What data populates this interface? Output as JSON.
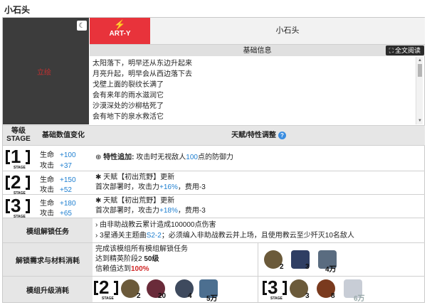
{
  "page_title": "小石头",
  "portrait_alt": "立绘",
  "class_tag": "ART-Y",
  "operator_name": "小石头",
  "info_header": "基础信息",
  "fulltext_button": "全文阅读",
  "poem_lines": [
    "太阳落下，明早还从东边升起来",
    "月亮升起，明早会从西边落下去",
    "戈壁上面的裂纹长满了",
    "会有来年的雨水滋润它",
    "沙漠深处的沙柳枯死了",
    "会有地下的泉水救活它"
  ],
  "table_headers": {
    "stage": "等级\nSTAGE",
    "stats": "基础数值变化",
    "talent": "天赋/特性调整"
  },
  "stages": [
    {
      "num": "1",
      "stat1_label": "生命",
      "stat1_value": "+100",
      "stat2_label": "攻击",
      "stat2_value": "+37",
      "line1_prefix": "特性追加:",
      "line1_a": "攻击时无视敌人",
      "line1_b": "100",
      "line1_c": "点的防御力",
      "line2": ""
    },
    {
      "num": "2",
      "stat1_label": "生命",
      "stat1_value": "+150",
      "stat2_label": "攻击",
      "stat2_value": "+52",
      "line1_prefix": "天赋【初出荒野】更新",
      "line2_a": "首次部署时，攻击力",
      "line2_b": "+16%",
      "line2_c": "，费用-3"
    },
    {
      "num": "3",
      "stat1_label": "生命",
      "stat1_value": "+180",
      "stat2_label": "攻击",
      "stat2_value": "+65",
      "line1_prefix": "天赋【初出荒野】更新",
      "line2_a": "首次部署时，攻击力",
      "line2_b": "+18%",
      "line2_c": "，费用-3"
    }
  ],
  "unlock": {
    "label": "模组解锁任务",
    "task1": "由非助战教云累计造成100000点伤害",
    "task2_a": "3星通关主题曲",
    "task2_b": "S2-2",
    "task2_c": "；必须编入非助战教云并上场，且使用教云至少歼灭10名敌人"
  },
  "requirements": {
    "label": "解锁需求与材料消耗",
    "line1": "完成该模组所有模组解锁任务",
    "line2_a": "达到精英阶段2",
    "line2_b": "50级",
    "line3_a": "信赖值达到",
    "line3_b": "100%",
    "items": [
      {
        "icon": "module-data-block-icon",
        "count": "2",
        "color": "#6b5a3a"
      },
      {
        "icon": "module-data-plate-icon",
        "count": "3",
        "color": "#2f3e63"
      },
      {
        "icon": "lmd-icon",
        "count": "4万",
        "color": "#5a6c80"
      }
    ]
  },
  "upgrade": {
    "label": "模组升级消耗",
    "stage2": {
      "num": "2",
      "items": [
        {
          "icon": "module-data-block-icon",
          "count": "2",
          "color": "#6b5a3a"
        },
        {
          "icon": "sugar-lump-icon",
          "count": "20",
          "color": "#6a2b3a"
        },
        {
          "icon": "orirock-concentration-icon",
          "count": "4",
          "color": "#3e4a5e"
        },
        {
          "icon": "lmd-icon",
          "count": "5万",
          "color": "#4c6f90"
        }
      ]
    },
    "stage3": {
      "num": "3",
      "items": [
        {
          "icon": "module-data-block-icon",
          "count": "3",
          "color": "#6b5a3a"
        },
        {
          "icon": "aketon-icon",
          "count": "8",
          "color": "#7a3a1e"
        },
        {
          "icon": "lmd-icon",
          "count": "6万",
          "color": "#c8cdd6"
        }
      ]
    }
  }
}
